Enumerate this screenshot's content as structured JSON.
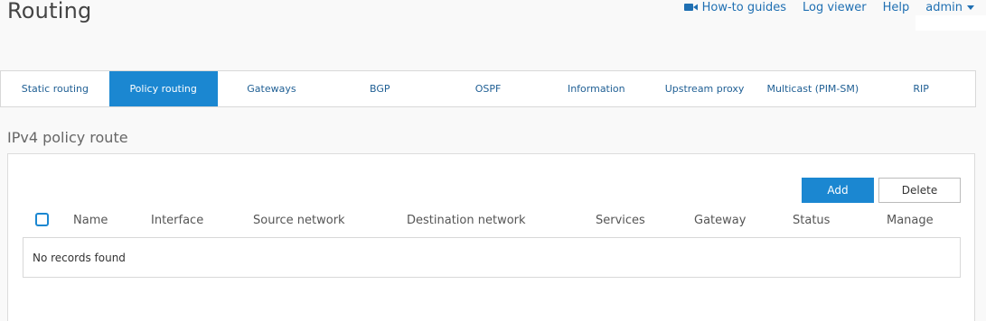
{
  "header": {
    "title": "Routing",
    "links": {
      "howto": "How-to guides",
      "logviewer": "Log viewer",
      "help": "Help",
      "user": "admin"
    }
  },
  "tabs": [
    {
      "label": "Static routing",
      "active": false
    },
    {
      "label": "Policy routing",
      "active": true
    },
    {
      "label": "Gateways",
      "active": false
    },
    {
      "label": "BGP",
      "active": false
    },
    {
      "label": "OSPF",
      "active": false
    },
    {
      "label": "Information",
      "active": false
    },
    {
      "label": "Upstream proxy",
      "active": false
    },
    {
      "label": "Multicast (PIM-SM)",
      "active": false
    },
    {
      "label": "RIP",
      "active": false
    }
  ],
  "section": {
    "title": "IPv4 policy route"
  },
  "toolbar": {
    "add_label": "Add",
    "delete_label": "Delete"
  },
  "table": {
    "columns": [
      "Name",
      "Interface",
      "Source network",
      "Destination network",
      "Services",
      "Gateway",
      "Status",
      "Manage"
    ],
    "empty_message": "No records found"
  },
  "colors": {
    "accent": "#1b87d1",
    "link": "#1f6fb2"
  }
}
